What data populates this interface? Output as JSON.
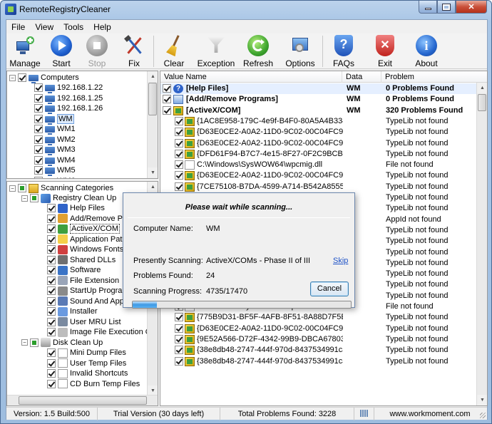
{
  "window": {
    "title": "RemoteRegistryCleaner"
  },
  "menu": [
    "File",
    "View",
    "Tools",
    "Help"
  ],
  "toolbar": [
    {
      "label": "Manage",
      "icon": "manage-icon",
      "enabled": true
    },
    {
      "label": "Start",
      "icon": "play-icon",
      "enabled": true
    },
    {
      "label": "Stop",
      "icon": "stop-icon",
      "enabled": false
    },
    {
      "label": "Fix",
      "icon": "fix-tools-icon",
      "enabled": true
    },
    {
      "label": "Clear",
      "icon": "broom-icon",
      "enabled": true
    },
    {
      "label": "Exception",
      "icon": "funnel-icon",
      "enabled": true
    },
    {
      "label": "Refresh",
      "icon": "refresh-icon",
      "enabled": true
    },
    {
      "label": "Options",
      "icon": "options-icon",
      "enabled": true
    },
    {
      "label": "FAQs",
      "icon": "shield-help-icon",
      "enabled": true
    },
    {
      "label": "Exit",
      "icon": "exit-shield-icon",
      "enabled": true
    },
    {
      "label": "About",
      "icon": "info-icon",
      "enabled": true
    }
  ],
  "computers": {
    "root": "Computers",
    "items": [
      "192.168.1.22",
      "192.168.1.25",
      "192.168.1.26",
      "WM",
      "WM1",
      "WM2",
      "WM3",
      "WM4",
      "WM5",
      "WM6"
    ]
  },
  "categories": {
    "root": "Scanning Categories",
    "registry": "Registry Clean Up",
    "registry_items": [
      "Help Files",
      "Add/Remove Pro",
      "ActiveX/COM",
      "Application Paths",
      "Windows Fonts",
      "Shared DLLs",
      "Software",
      "File Extension",
      "StartUp Programs",
      "Sound And AppEvents",
      "Installer",
      "User MRU List",
      "Image File Execution Opti"
    ],
    "disk": "Disk Clean Up",
    "disk_items": [
      "Mini Dump Files",
      "User Temp Files",
      "Invalid Shortcuts",
      "CD Burn Temp Files"
    ]
  },
  "list": {
    "columns": [
      "Value Name",
      "Data",
      "Problem"
    ],
    "groups": [
      {
        "name": "[Help Files]",
        "data": "WM",
        "problem": "0 Problems Found",
        "icon": "help"
      },
      {
        "name": "[Add/Remove Programs]",
        "data": "WM",
        "problem": "0 Problems Found",
        "icon": "prog"
      },
      {
        "name": "[ActiveX/COM]",
        "data": "WM",
        "problem": "320 Problems Found",
        "icon": "cube"
      }
    ],
    "rows": [
      {
        "name": "{1AC8E958-179C-4e9f-B4F0-80A5A4B33486}",
        "problem": "TypeLib not found",
        "icon": "cube"
      },
      {
        "name": "{D63E0CE2-A0A2-11D0-9C02-00C04FC99C8E}",
        "problem": "TypeLib not found",
        "icon": "cube"
      },
      {
        "name": "{D63E0CE2-A0A2-11D0-9C02-00C04FC99C8E}",
        "problem": "TypeLib not found",
        "icon": "cube"
      },
      {
        "name": "{DFD61F94-B7C7-4e15-8F27-0F2C9BCB420C}",
        "problem": "TypeLib not found",
        "icon": "cube"
      },
      {
        "name": "C:\\Windows\\SysWOW64\\wpcmig.dll",
        "problem": "File not found",
        "icon": "file"
      },
      {
        "name": "{D63E0CE2-A0A2-11D0-9C02-00C04FC99C8E}",
        "problem": "TypeLib not found",
        "icon": "cube"
      },
      {
        "name": "{7CE75108-B7DA-4599-A714-B542A8555357}",
        "problem": "TypeLib not found",
        "icon": "cube"
      },
      {
        "name": "",
        "problem": "TypeLib not found",
        "icon": "cube"
      },
      {
        "name": "",
        "problem": "TypeLib not found",
        "icon": "cube"
      },
      {
        "name": "",
        "problem": "AppId not found",
        "icon": "cube"
      },
      {
        "name": "",
        "problem": "TypeLib not found",
        "icon": "cube"
      },
      {
        "name": "",
        "problem": "TypeLib not found",
        "icon": "cube"
      },
      {
        "name": "",
        "problem": "TypeLib not found",
        "icon": "cube"
      },
      {
        "name": "",
        "problem": "TypeLib not found",
        "icon": "cube"
      },
      {
        "name": "{775B9D31-BF5F-4AFB-8F51-8A88D7F5E3FF}",
        "problem": "TypeLib not found",
        "icon": "cube"
      },
      {
        "name": "{D63E0CE2-A0A2-11D0-9C02-00C04FC99C8E}",
        "problem": "TypeLib not found",
        "icon": "cube"
      },
      {
        "name": "{9E52A566-D72F-4342-99B9-DBCA6780385F}",
        "problem": "TypeLib not found",
        "icon": "cube"
      },
      {
        "name": "C:\\Windows\\SysWOW64\\wpcumi.dll",
        "problem": "File not found",
        "icon": "file"
      },
      {
        "name": "{775B9D31-BF5F-4AFB-8F51-8A88D7F5E3FF}",
        "problem": "TypeLib not found",
        "icon": "cube"
      },
      {
        "name": "{D63E0CE2-A0A2-11D0-9C02-00C04FC99C8E}",
        "problem": "TypeLib not found",
        "icon": "cube"
      },
      {
        "name": "{9E52A566-D72F-4342-99B9-DBCA6780385F}",
        "problem": "TypeLib not found",
        "icon": "cube"
      },
      {
        "name": "{38e8db48-2747-444f-970d-8437534991ca}",
        "problem": "TypeLib not found",
        "icon": "cube"
      },
      {
        "name": "{38e8db48-2747-444f-970d-8437534991ca}",
        "problem": "TypeLib not found",
        "icon": "cube"
      }
    ]
  },
  "dialog": {
    "title": "Please wait while scanning...",
    "computer_label": "Computer Name:",
    "computer_value": "WM",
    "scanning_label": "Presently Scanning:",
    "scanning_value": "ActiveX/COMs - Phase II of III",
    "skip": "Skip",
    "problems_label": "Problems Found:",
    "problems_value": "24",
    "progress_label": "Scanning Progress:",
    "progress_value": "4735/17470",
    "progress_fraction": 0.11,
    "cancel": "Cancel"
  },
  "status": {
    "version": "Version: 1.5 Build:500",
    "trial": "Trial Version (30 days left)",
    "total": "Total Problems Found: 3228",
    "website": "www.workmoment.com"
  }
}
